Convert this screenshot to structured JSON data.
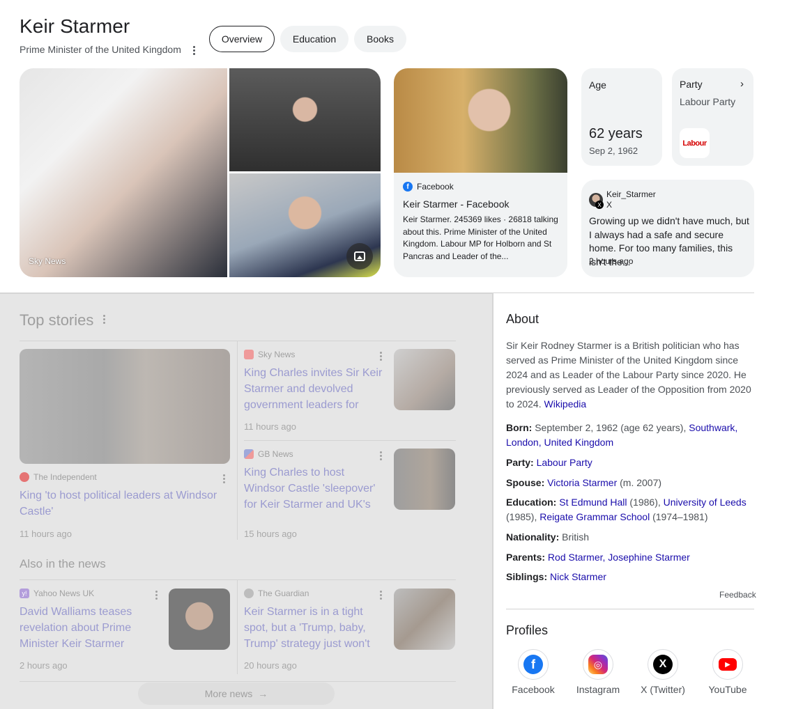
{
  "header": {
    "title": "Keir Starmer",
    "subtitle": "Prime Minister of the United Kingdom",
    "tabs": [
      {
        "label": "Overview",
        "active": true
      },
      {
        "label": "Education",
        "active": false
      },
      {
        "label": "Books",
        "active": false
      }
    ]
  },
  "images": {
    "main_credit": "Sky News"
  },
  "facebook_card": {
    "source": "Facebook",
    "title": "Keir Starmer - Facebook",
    "snippet": "Keir Starmer. 245369 likes · 26818 talking about this. Prime Minister of the United Kingdom. Labour MP for Holborn and St Pancras and Leader of the..."
  },
  "age_card": {
    "label": "Age",
    "value": "62 years",
    "date": "Sep 2, 1962"
  },
  "party_card": {
    "label": "Party",
    "name": "Labour Party",
    "logo_text": "Labour"
  },
  "twitter_card": {
    "handle": "Keir_Starmer",
    "network": "X",
    "text": "Growing up we didn't have much, but I always had a safe and secure home. For too many families, this isn't the...",
    "time": "2 hours ago"
  },
  "top_stories": {
    "title": "Top stories",
    "main": {
      "source": "The Independent",
      "headline": "King 'to host political leaders at Windsor Castle'",
      "time": "11 hours ago"
    },
    "side": [
      {
        "source": "Sky News",
        "headline": "King Charles invites Sir Keir Starmer and devolved government leaders for din...",
        "time": "11 hours ago"
      },
      {
        "source": "GB News",
        "headline": "King Charles to host Windsor Castle 'sleepover' for Keir Starmer and UK's devolved...",
        "time": "15 hours ago"
      }
    ],
    "also_title": "Also in the news",
    "also": [
      {
        "source": "Yahoo News UK",
        "headline": "David Walliams teases revelation about Prime Minister Keir Starmer",
        "time": "2 hours ago"
      },
      {
        "source": "The Guardian",
        "headline": "Keir Starmer is in a tight spot, but a 'Trump, baby, Trump' strategy just won't work |...",
        "time": "20 hours ago"
      }
    ],
    "more_label": "More news"
  },
  "about": {
    "title": "About",
    "text": "Sir Keir Rodney Starmer is a British politician who has served as Prime Minister of the United Kingdom since 2024 and as Leader of the Labour Party since 2020. He previously served as Leader of the Opposition from 2020 to 2024.",
    "wiki_link": "Wikipedia",
    "born_label": "Born:",
    "born_text": "September 2, 1962 (age 62 years),",
    "born_link1": "Southwark,",
    "born_link2": "London,",
    "born_link3": "United Kingdom",
    "party_label": "Party:",
    "party_link": "Labour Party",
    "spouse_label": "Spouse:",
    "spouse_link": "Victoria Starmer",
    "spouse_extra": "(m. 2007)",
    "education_label": "Education:",
    "edu_link1": "St Edmund Hall",
    "edu_year1": "(1986),",
    "edu_link2": "University of Leeds",
    "edu_year2": "(1985),",
    "edu_link3": "Reigate Grammar School",
    "edu_year3": "(1974–1981)",
    "nationality_label": "Nationality:",
    "nationality_value": "British",
    "parents_label": "Parents:",
    "parents_link1": "Rod Starmer,",
    "parents_link2": "Josephine Starmer",
    "siblings_label": "Siblings:",
    "siblings_link": "Nick Starmer",
    "feedback": "Feedback"
  },
  "profiles": {
    "title": "Profiles",
    "items": [
      {
        "label": "Facebook",
        "icon": "facebook-icon"
      },
      {
        "label": "Instagram",
        "icon": "instagram-icon"
      },
      {
        "label": "X (Twitter)",
        "icon": "x-icon"
      },
      {
        "label": "YouTube",
        "icon": "youtube-icon"
      }
    ]
  },
  "colors": {
    "link": "#1a0dab",
    "facebook": "#1877f2",
    "labour": "#d50000",
    "youtube": "#ff0000"
  }
}
